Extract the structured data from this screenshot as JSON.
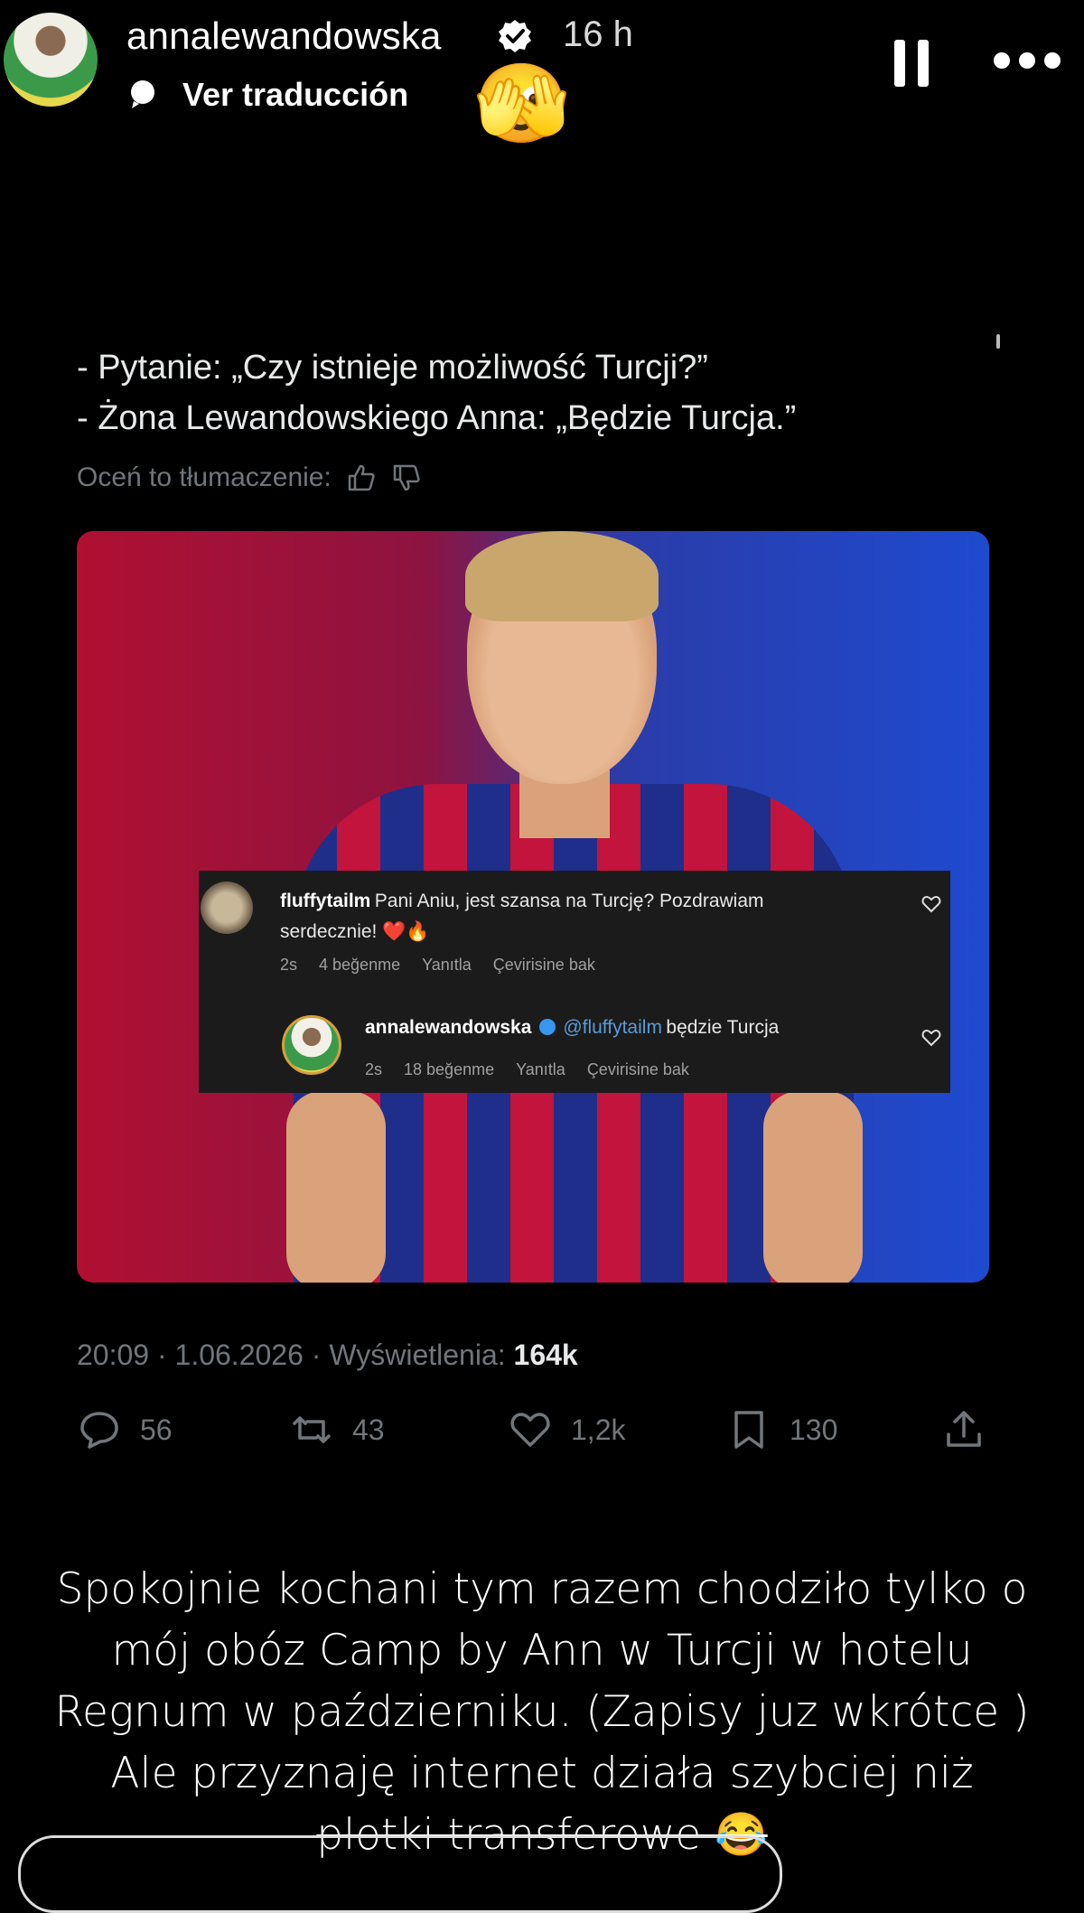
{
  "story_header": {
    "username": "annalewandowska",
    "time_ago": "16 h",
    "translate_label": "Ver traducción",
    "sticker_emoji": "🫣"
  },
  "tweet": {
    "lines": [
      "- Pytanie: „Czy istnieje możliwość Turcji?”",
      "- Żona Lewandowskiego Anna: „Będzie Turcja.”"
    ],
    "rate_translation_label": "Oceń to tłumaczenie:",
    "timestamp": "20:09 · 1.06.2026 · Wyświetlenia:",
    "views": "164k",
    "stats": {
      "replies": "56",
      "retweets": "43",
      "likes": "1,2k",
      "bookmarks": "130"
    }
  },
  "comments": [
    {
      "username": "fluffytailm",
      "text_line1": "Pani Aniu, jest szansa na Turcję? Pozdrawiam",
      "text_line2": "serdecznie! ❤️🔥",
      "age": "2s",
      "likes": "4 beğenme",
      "reply": "Yanıtla",
      "translate": "Çevirisine bak"
    },
    {
      "username": "annalewandowska",
      "mention": "@fluffytailm",
      "text": "będzie Turcja",
      "age": "2s",
      "likes": "18 beğenme",
      "reply": "Yanıtla",
      "translate": "Çevirisine bak"
    }
  ],
  "caption": {
    "line1": "Spokojnie kochani tym razem chodziło tylko o",
    "line2": "mój obóz Camp by Ann w Turcji w hotelu",
    "line3": "Regnum w październiku. (Zapisy juz wkrótce )",
    "line4": "Ale przyznaję internet działa szybciej niż",
    "line5": "plotki transferowe 😂"
  },
  "colors": {
    "background": "#000000",
    "muted_text": "#71767b",
    "tweet_text": "#e7e9ea",
    "mention": "#5b9bd5"
  },
  "icons": [
    "verified-badge-icon",
    "translate-bubble-icon",
    "pause-icon",
    "more-icon",
    "thumbs-up-icon",
    "thumbs-down-icon",
    "reply-icon",
    "retweet-icon",
    "like-icon",
    "bookmark-icon",
    "share-icon",
    "heart-outline-icon"
  ]
}
